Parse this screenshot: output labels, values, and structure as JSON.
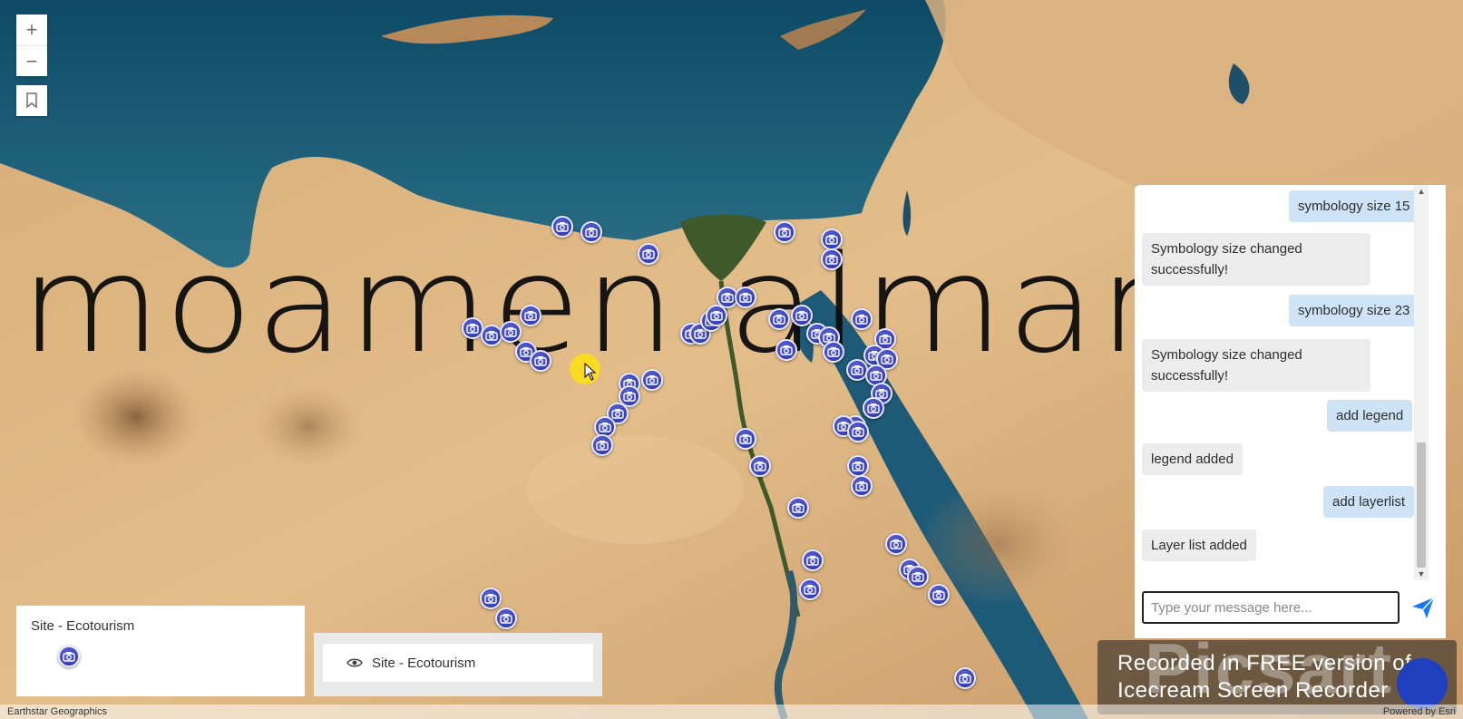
{
  "map": {
    "basemap_attribution": "Earthstar Geographics",
    "powered_by": "Powered by Esri",
    "watermark_text": "moamen almamly",
    "marker_icon": "camera-icon",
    "marker_color": "#2f3aa8"
  },
  "controls": {
    "zoom_in_icon": "plus-icon",
    "zoom_out_icon": "minus-icon",
    "bookmarks_icon": "bookmark-icon",
    "zoom_in_label": "+",
    "zoom_out_label": "−"
  },
  "legend": {
    "title": "Site - Ecotourism",
    "symbol_icon": "camera-icon"
  },
  "layer_list": {
    "items": [
      {
        "label": "Site - Ecotourism",
        "visible": true,
        "icon": "eye-icon"
      }
    ]
  },
  "chat": {
    "messages": [
      {
        "role": "user",
        "text": "symbology size 15"
      },
      {
        "role": "bot",
        "text": "Symbology size changed successfully!"
      },
      {
        "role": "user",
        "text": "symbology size 23"
      },
      {
        "role": "bot",
        "text": "Symbology size changed successfully!"
      },
      {
        "role": "user",
        "text": "add legend"
      },
      {
        "role": "bot",
        "text": "legend added"
      },
      {
        "role": "user",
        "text": "add layerlist"
      },
      {
        "role": "bot",
        "text": "Layer list added"
      }
    ],
    "input_placeholder": "Type your message here...",
    "input_value": "",
    "send_icon": "send-icon",
    "user_bubble_color": "#cfe3f7",
    "bot_bubble_color": "#ececec"
  },
  "recorder_watermark": {
    "big_text": "Picsart",
    "line1": "Recorded in FREE version of",
    "line2": "Icecream   Screen   Recorder"
  }
}
